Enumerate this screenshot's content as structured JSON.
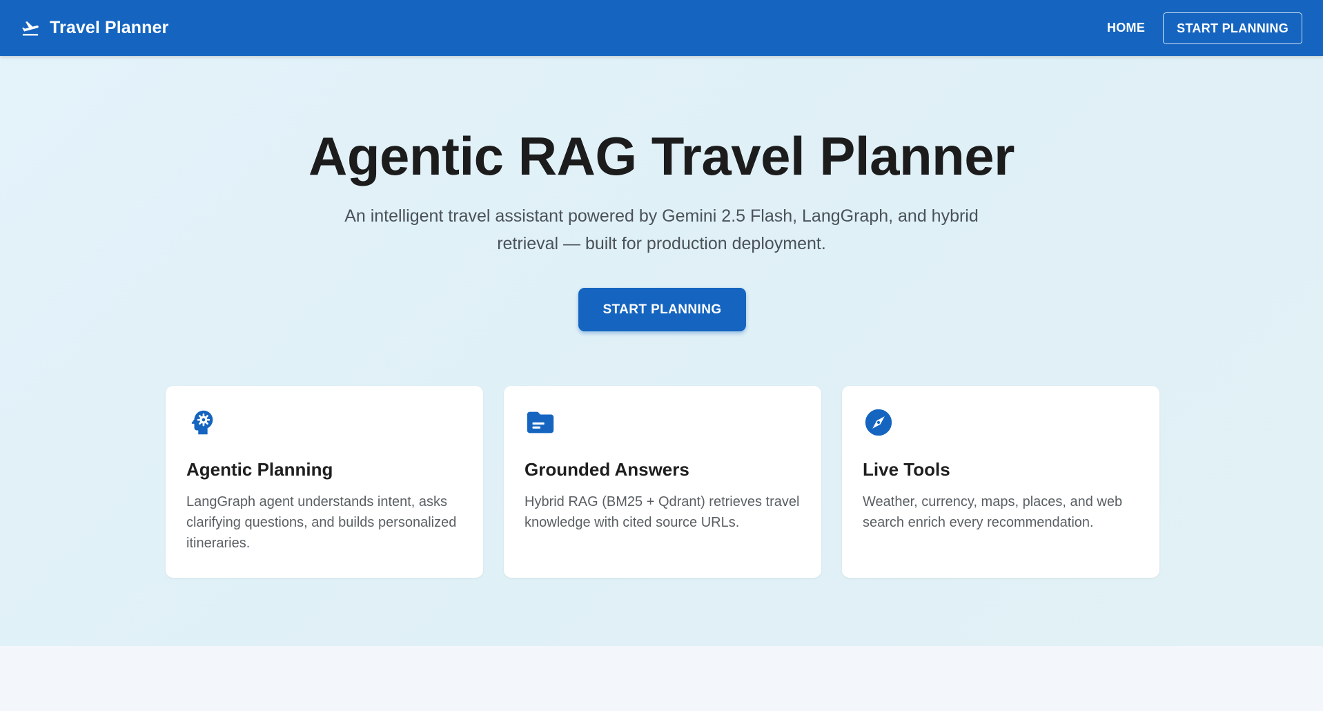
{
  "appbar": {
    "brand_icon": "flight-takeoff-icon",
    "title": "Travel Planner",
    "nav": {
      "home_label": "HOME",
      "start_label": "START PLANNING"
    }
  },
  "hero": {
    "title": "Agentic RAG Travel Planner",
    "subtitle": "An intelligent travel assistant powered by Gemini 2.5 Flash, LangGraph, and hybrid retrieval — built for production deployment.",
    "cta_label": "START PLANNING"
  },
  "features": [
    {
      "icon": "psychology-icon",
      "title": "Agentic Planning",
      "text": "LangGraph agent understands intent, asks clarifying questions, and builds personalized itineraries."
    },
    {
      "icon": "folder-icon",
      "title": "Grounded Answers",
      "text": "Hybrid RAG (BM25 + Qdrant) retrieves travel knowledge with cited source URLs."
    },
    {
      "icon": "compass-icon",
      "title": "Live Tools",
      "text": "Weather, currency, maps, places, and web search enrich every recommendation."
    }
  ],
  "colors": {
    "primary": "#1565c0",
    "hero_bg": "#e1f1f8",
    "page_bg": "#f3f7fb",
    "title_text": "#1c1c1c",
    "body_text": "#5a5f63"
  }
}
